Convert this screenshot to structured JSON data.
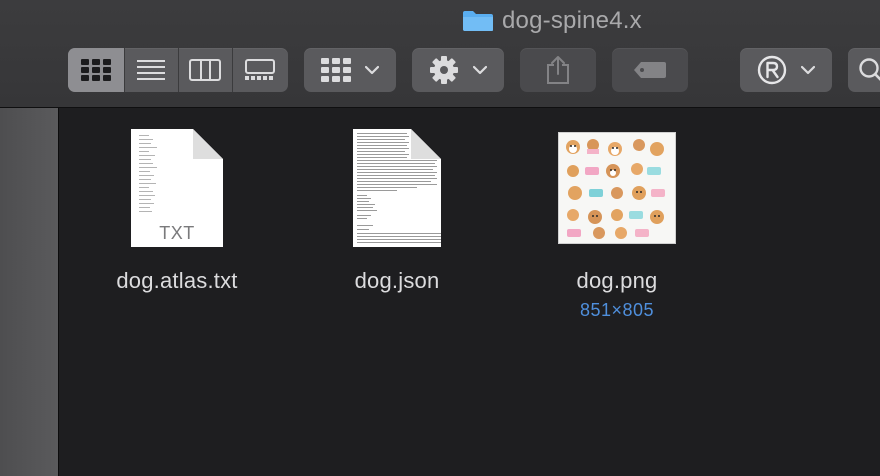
{
  "window": {
    "title": "dog-spine4.x",
    "title_icon": "folder-icon"
  },
  "toolbar": {
    "view_modes": [
      {
        "name": "icon-view",
        "icon": "grid-icon",
        "active": true
      },
      {
        "name": "list-view",
        "icon": "list-icon",
        "active": false
      },
      {
        "name": "column-view",
        "icon": "columns-icon",
        "active": false
      },
      {
        "name": "gallery-view",
        "icon": "gallery-icon",
        "active": false
      }
    ],
    "group_button_icon": "group-grid-icon",
    "action_button_icon": "gear-icon",
    "share_button_icon": "share-icon",
    "tag_button_icon": "tag-icon",
    "extension_button_icon": "registered-icon",
    "search_button_icon": "search-icon"
  },
  "files": [
    {
      "name": "dog.atlas.txt",
      "kind": "text-document",
      "ext_label": "TXT",
      "meta": ""
    },
    {
      "name": "dog.json",
      "kind": "json-document",
      "ext_label": "",
      "meta": ""
    },
    {
      "name": "dog.png",
      "kind": "image",
      "ext_label": "",
      "meta": "851×805"
    }
  ],
  "colors": {
    "accent": "#4f8fdc",
    "folder": "#5aaef0",
    "background": "#1e1e20"
  }
}
